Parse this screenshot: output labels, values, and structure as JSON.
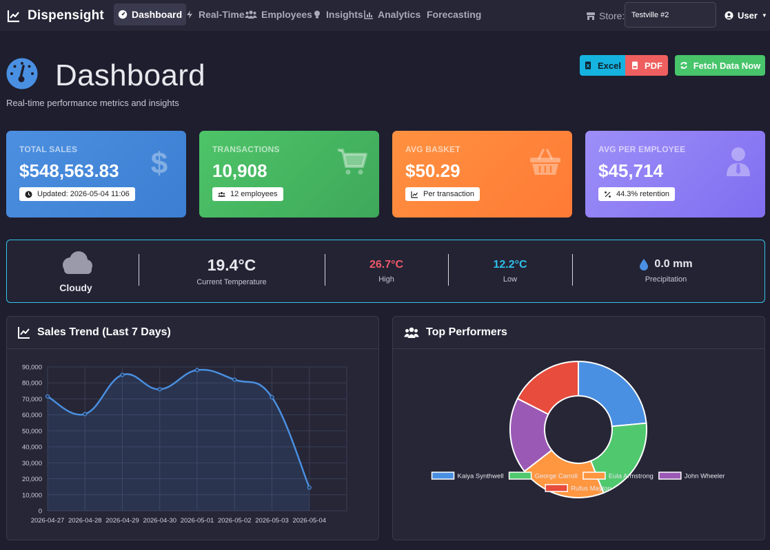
{
  "navbar": {
    "brand": "Dispensight",
    "items": [
      {
        "label": "Dashboard",
        "active": true
      },
      {
        "label": "Real-Time"
      },
      {
        "label": "Employees"
      },
      {
        "label": "Insights"
      },
      {
        "label": "Analytics"
      },
      {
        "label": "Forecasting"
      }
    ],
    "store_label": "Store:",
    "store_value": "Testville #2",
    "user_label": "User"
  },
  "header": {
    "title": "Dashboard",
    "subtitle": "Real-time performance metrics and insights",
    "buttons": {
      "excel": "Excel",
      "pdf": "PDF",
      "fetch": "Fetch Data Now"
    }
  },
  "stats": [
    {
      "label": "TOTAL SALES",
      "value": "$548,563.83",
      "badge": "Updated: 2026-05-04 11:06",
      "icon": "dollar-icon"
    },
    {
      "label": "TRANSACTIONS",
      "value": "10,908",
      "badge": "12 employees",
      "icon": "cart-icon"
    },
    {
      "label": "AVG BASKET",
      "value": "$50.29",
      "badge": "Per transaction",
      "icon": "basket-icon"
    },
    {
      "label": "AVG PER EMPLOYEE",
      "value": "$45,714",
      "badge": "44.3% retention",
      "icon": "user-tie-icon"
    }
  ],
  "weather": {
    "condition": "Cloudy",
    "temperature": "19.4°C",
    "temperature_label": "Current Temperature",
    "high": "26.7°C",
    "high_label": "High",
    "low": "12.2°C",
    "low_label": "Low",
    "precipitation": "0.0 mm",
    "precipitation_label": "Precipitation",
    "colors": {
      "high": "#f05a6a",
      "low": "#2ec0ea",
      "border": "#36c5ea"
    }
  },
  "panels": {
    "sales_trend_title": "Sales Trend (Last 7 Days)",
    "top_performers_title": "Top Performers"
  },
  "chart_data": [
    {
      "type": "area",
      "x": [
        "2026-04-27",
        "2026-04-28",
        "2026-04-29",
        "2026-04-30",
        "2026-05-01",
        "2026-05-02",
        "2026-05-03",
        "2026-05-04"
      ],
      "values": [
        71500,
        60500,
        85000,
        76000,
        88000,
        82000,
        71000,
        14500
      ],
      "ylim": [
        0,
        90000
      ],
      "yticks": [
        0,
        10000,
        20000,
        30000,
        40000,
        50000,
        60000,
        70000,
        80000,
        90000
      ],
      "grid": true,
      "color": "#4a8fe0"
    },
    {
      "type": "pie",
      "labels": [
        "Kaiya Synthwell",
        "George Carroll",
        "Eula Armstrong",
        "John Wheeler",
        "Rufus Mayton"
      ],
      "values": [
        23.5,
        20.5,
        20.5,
        18,
        17.5
      ],
      "colors": [
        "#4a90e2",
        "#50c86e",
        "#ff9640",
        "#9b59b6",
        "#e74c3c"
      ],
      "legend": "bottom"
    }
  ]
}
